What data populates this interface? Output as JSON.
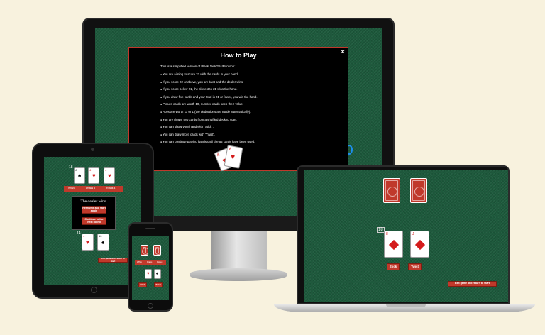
{
  "colors": {
    "felt": "#1d5a3c",
    "accent": "#c0392b",
    "background": "#f8f2de"
  },
  "monitor": {
    "modal": {
      "title": "How to Play",
      "close": "×",
      "intro": "This is a simplified version of Black Jack/21s/Pontoon:",
      "rules": [
        "You are aiming to score 21 with the cards in your hand.",
        "If you score 22 or above, you are bust and the dealer wins.",
        "If you score below 21, the closest to 21 wins the hand.",
        "If you draw five cards and your total is 21 or fewer, you win the hand.",
        "Picture cards are worth 10, number cards keep their value.",
        "Aces are worth 11 or 1 (the deductions are made automatically).",
        "You are drawn two cards from a shuffled deck to start.",
        "You can show your hand with \"Stick\".",
        "You can draw more cards with \"Twist\".",
        "You can continue playing hands until the 52 cards have been used."
      ],
      "cards": {
        "rank": "A",
        "suit": "♥"
      }
    }
  },
  "tablet": {
    "dealer_score": "18",
    "dealer_cards": [
      {
        "rank": "J",
        "suit": "♠"
      },
      {
        "rank": "4",
        "suit": "♥"
      },
      {
        "rank": "4",
        "suit": "♥"
      }
    ],
    "score_bar": {
      "wins": "WINS",
      "draws": "Draws 5",
      "losses": "Rotas 4"
    },
    "result_message": "The dealer wins.",
    "shuffle_btn": "Reshuffle and start again",
    "continue_btn": "Continue to the next round",
    "player_score": "14",
    "player_cards": [
      {
        "rank": "4",
        "suit": "♥"
      },
      {
        "rank": "10",
        "suit": "♠"
      }
    ],
    "exit_btn": "Exit game and return to start"
  },
  "phone": {
    "score_bar": {
      "wins": "WINS",
      "draws": "Draws",
      "losses": "Rotas 4"
    },
    "player_cards": [
      {
        "rank": "4",
        "suit": "♥"
      },
      {
        "rank": "10",
        "suit": "♠"
      }
    ],
    "stick_btn": "Stick",
    "twist_btn": "Twist"
  },
  "laptop": {
    "player_score": "18",
    "player_cards": [
      {
        "rank": "8",
        "suit": "♦"
      },
      {
        "rank": "J",
        "suit": "♦"
      }
    ],
    "stick_btn": "Stick",
    "twist_btn": "Twist",
    "exit_btn": "Exit game and return to start"
  }
}
